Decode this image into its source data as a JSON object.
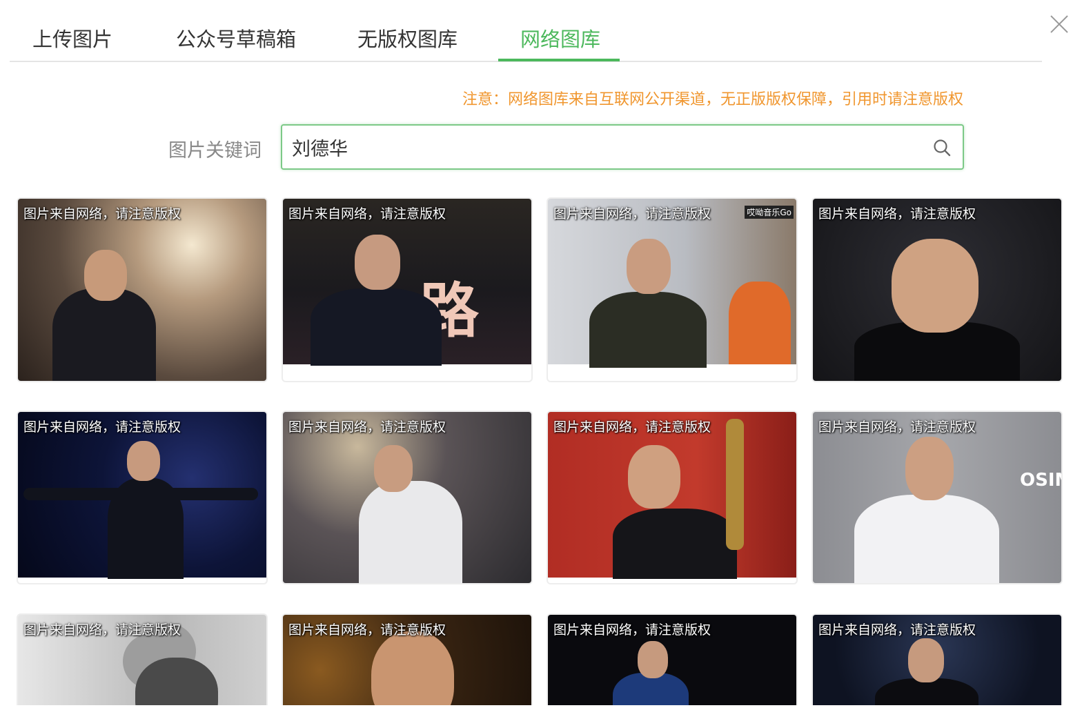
{
  "tabs": [
    {
      "label": "上传图片"
    },
    {
      "label": "公众号草稿箱"
    },
    {
      "label": "无版权图库"
    },
    {
      "label": "网络图库"
    }
  ],
  "active_tab": "网络图库",
  "notice": "注意：网络图库来自互联网公开渠道，无正版版权保障，引用时请注意版权",
  "search": {
    "label": "图片关键词",
    "value": "刘德华"
  },
  "images": [
    {
      "caption": "图片来自网络，请注意版权",
      "bg": "#6b5b4d"
    },
    {
      "caption": "图片来自网络，请注意版权",
      "bg": "#1f1d22",
      "overlay_text": "路"
    },
    {
      "caption": "图片来自网络，请注意版权",
      "bg": "#c9ccd1",
      "watermark": "哎呦音乐Go"
    },
    {
      "caption": "图片来自网络，请注意版权",
      "bg": "#1c1c1f"
    },
    {
      "caption": "图片来自网络，请注意版权",
      "bg": "#0c1230"
    },
    {
      "caption": "图片来自网络，请注意版权",
      "bg": "#3b3a3c"
    },
    {
      "caption": "图片来自网络，请注意版权",
      "bg": "#a8261f"
    },
    {
      "caption": "图片来自网络，请注意版权",
      "bg": "#9a9b9f",
      "overlay_text": "OSIM*"
    },
    {
      "caption": "图片来自网络，请注意版权",
      "bg": "#d9d9d9"
    },
    {
      "caption": "图片来自网络，请注意版权",
      "bg": "#3a2712"
    },
    {
      "caption": "图片来自网络，请注意版权",
      "bg": "#0b0b10"
    },
    {
      "caption": "图片来自网络，请注意版权",
      "bg": "#0f1320"
    }
  ],
  "colors": {
    "accent": "#4cb85c",
    "notice": "#f0962e"
  }
}
